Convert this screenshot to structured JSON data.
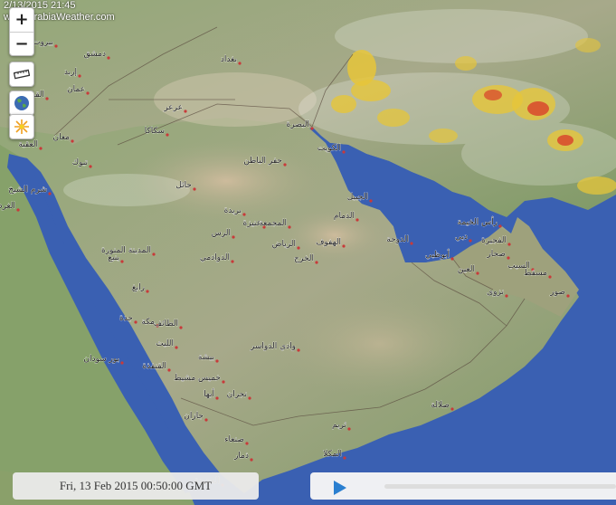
{
  "watermark": {
    "line1": "2/13/2015 21:45",
    "line2": "www.ArabiaWeather.com"
  },
  "controls": {
    "zoom_in": "+",
    "zoom_out": "−",
    "ruler_icon": "ruler-icon",
    "globe_icon": "globe-icon",
    "lightning_icon": "lightning-icon"
  },
  "timestamp": "Fri, 13 Feb 2015 00:50:00 GMT",
  "colors": {
    "sea": "#3a5fb0",
    "land": "#8aa068",
    "desert": "#c8b89a",
    "rain_light": "#e6c53a",
    "rain_heavy": "#d8402a"
  },
  "cities": [
    {
      "name": "بيروت",
      "icon": "city-dot"
    },
    {
      "name": "دمشق",
      "icon": "city-dot"
    },
    {
      "name": "إربد",
      "icon": "city-dot"
    },
    {
      "name": "عمان",
      "icon": "city-dot"
    },
    {
      "name": "القدس",
      "icon": "city-dot"
    },
    {
      "name": "العقبة",
      "icon": "city-dot"
    },
    {
      "name": "معان",
      "icon": "city-dot"
    },
    {
      "name": "تبوك",
      "icon": "city-dot"
    },
    {
      "name": "بغداد",
      "icon": "city-dot"
    },
    {
      "name": "عرعر",
      "icon": "city-dot"
    },
    {
      "name": "سكاكا",
      "icon": "city-dot"
    },
    {
      "name": "البصرة",
      "icon": "city-dot"
    },
    {
      "name": "الكويت",
      "icon": "city-dot"
    },
    {
      "name": "حفر الباطن",
      "icon": "city-dot"
    },
    {
      "name": "حائل",
      "icon": "city-dot"
    },
    {
      "name": "شرم الشيخ",
      "icon": "city-dot"
    },
    {
      "name": "الغردقة",
      "icon": "city-dot"
    },
    {
      "name": "الجبيل",
      "icon": "city-dot"
    },
    {
      "name": "الدمام",
      "icon": "city-dot"
    },
    {
      "name": "بريدة",
      "icon": "city-dot"
    },
    {
      "name": "عنيزة",
      "icon": "city-dot"
    },
    {
      "name": "المجمعة",
      "icon": "city-dot"
    },
    {
      "name": "الرس",
      "icon": "city-dot"
    },
    {
      "name": "الدوحة",
      "icon": "city-dot"
    },
    {
      "name": "المدينة المنورة",
      "icon": "city-dot"
    },
    {
      "name": "ينبع",
      "icon": "city-dot"
    },
    {
      "name": "الدوادمي",
      "icon": "city-dot"
    },
    {
      "name": "الرياض",
      "icon": "city-dot"
    },
    {
      "name": "الهفوف",
      "icon": "city-dot"
    },
    {
      "name": "الخرج",
      "icon": "city-dot"
    },
    {
      "name": "رأس الخيمة",
      "icon": "city-dot"
    },
    {
      "name": "دبي",
      "icon": "city-dot"
    },
    {
      "name": "أبوظبي",
      "icon": "city-dot"
    },
    {
      "name": "الفجيرة",
      "icon": "city-dot"
    },
    {
      "name": "صحار",
      "icon": "city-dot"
    },
    {
      "name": "السيب",
      "icon": "city-dot"
    },
    {
      "name": "مسقط",
      "icon": "city-dot"
    },
    {
      "name": "صور",
      "icon": "city-dot"
    },
    {
      "name": "العين",
      "icon": "city-dot"
    },
    {
      "name": "نزوى",
      "icon": "city-dot"
    },
    {
      "name": "رابغ",
      "icon": "city-dot"
    },
    {
      "name": "جدة",
      "icon": "city-dot"
    },
    {
      "name": "مكة",
      "icon": "city-dot"
    },
    {
      "name": "الطائف",
      "icon": "city-dot"
    },
    {
      "name": "الليث",
      "icon": "city-dot"
    },
    {
      "name": "وادي الدواسر",
      "icon": "city-dot"
    },
    {
      "name": "بور سودان",
      "icon": "city-dot"
    },
    {
      "name": "القنفذة",
      "icon": "city-dot"
    },
    {
      "name": "بيشة",
      "icon": "city-dot"
    },
    {
      "name": "خميس مشيط",
      "icon": "city-dot"
    },
    {
      "name": "أبها",
      "icon": "city-dot"
    },
    {
      "name": "نجران",
      "icon": "city-dot"
    },
    {
      "name": "جازان",
      "icon": "city-dot"
    },
    {
      "name": "صلالة",
      "icon": "city-dot"
    },
    {
      "name": "ثريم",
      "icon": "city-dot"
    },
    {
      "name": "صنعاء",
      "icon": "city-dot"
    },
    {
      "name": "ذمار",
      "icon": "city-dot"
    },
    {
      "name": "الحديدة",
      "icon": "city-dot"
    },
    {
      "name": "المكلا",
      "icon": "city-dot"
    }
  ]
}
